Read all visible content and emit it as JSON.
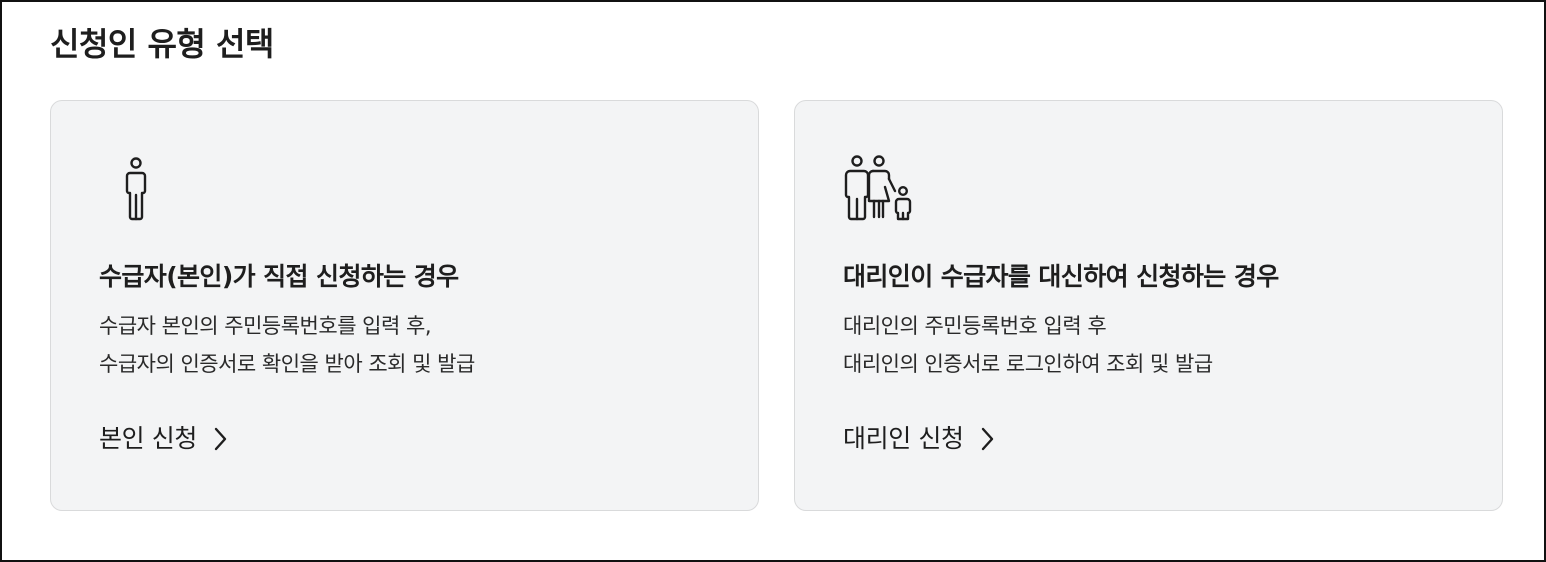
{
  "page": {
    "title": "신청인 유형 선택"
  },
  "options": [
    {
      "icon": "person-icon",
      "heading": "수급자(본인)가 직접 신청하는 경우",
      "desc_line1": "수급자 본인의 주민등록번호를 입력 후,",
      "desc_line2": "수급자의 인증서로 확인을 받아 조회 및 발급",
      "link_label": "본인 신청"
    },
    {
      "icon": "family-icon",
      "heading": "대리인이 수급자를 대신하여 신청하는 경우",
      "desc_line1": "대리인의 주민등록번호 입력 후",
      "desc_line2": "대리인의 인증서로 로그인하여 조회 및 발급",
      "link_label": "대리인 신청"
    }
  ],
  "colors": {
    "card_bg": "#f3f4f5",
    "card_border": "#d9dadb",
    "text": "#1e1e1e"
  }
}
